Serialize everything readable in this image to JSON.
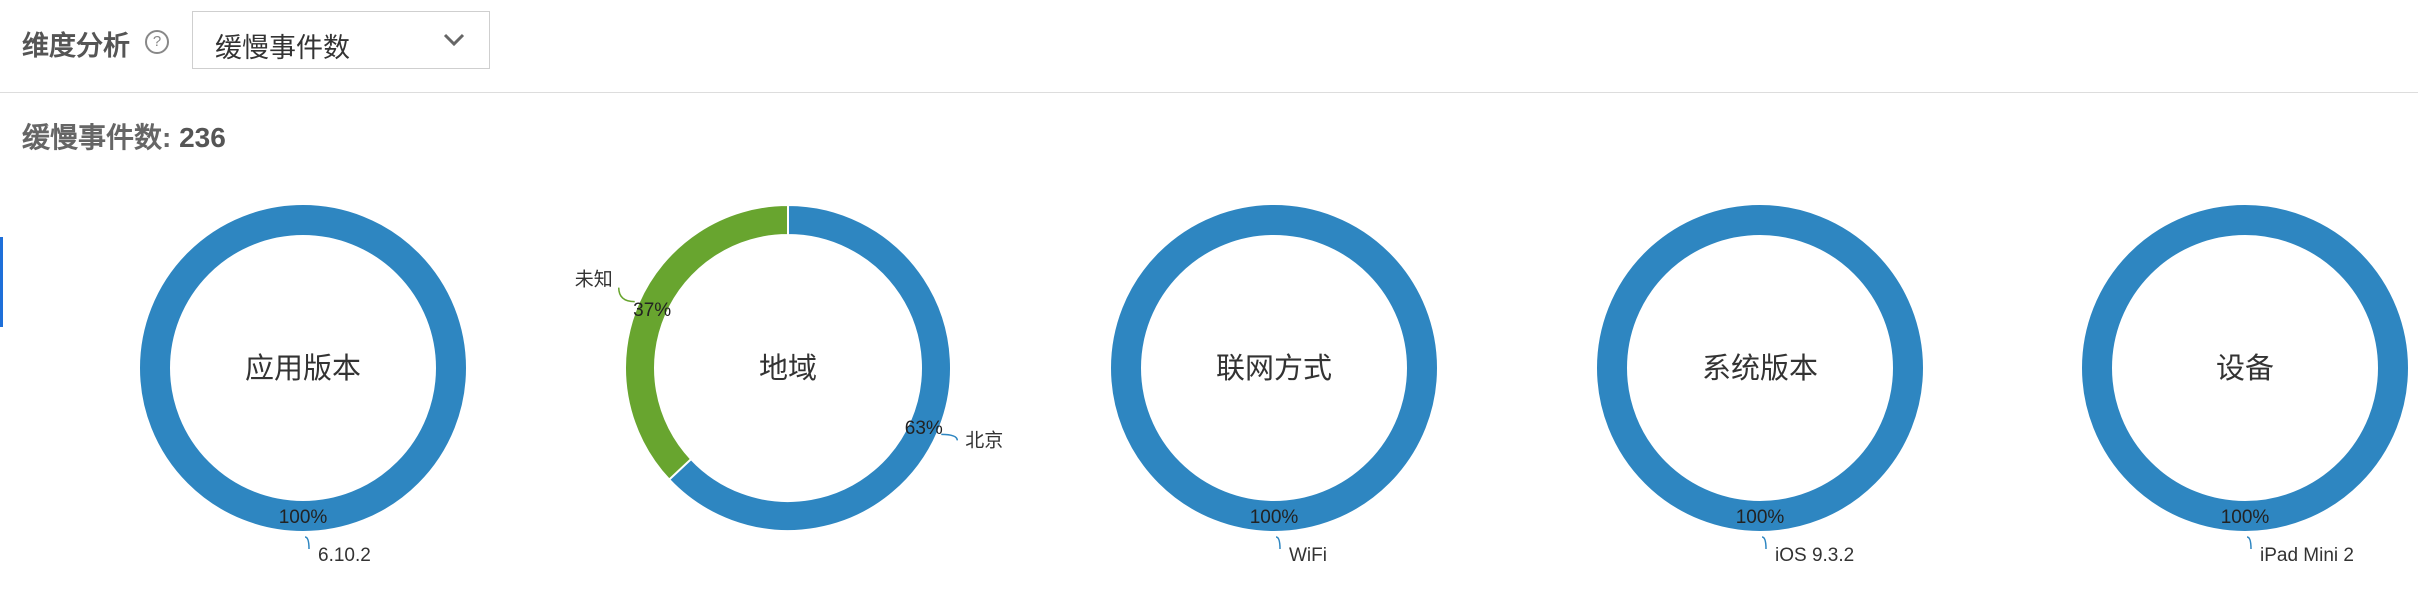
{
  "header": {
    "dimension_label": "维度分析",
    "help_icon": "?",
    "select_value": "缓慢事件数"
  },
  "summary": {
    "label": "缓慢事件数:",
    "value": "236"
  },
  "colors": {
    "blue": "#2e86c1",
    "green": "#68a52f"
  },
  "chart_data": [
    {
      "type": "pie",
      "style": "donut",
      "title": "应用版本",
      "slices": [
        {
          "label": "6.10.2",
          "value": 100,
          "display": "100%",
          "color": "#2e86c1"
        }
      ]
    },
    {
      "type": "pie",
      "style": "donut",
      "title": "地域",
      "slices": [
        {
          "label": "北京",
          "value": 63,
          "display": "63%",
          "color": "#2e86c1"
        },
        {
          "label": "未知",
          "value": 37,
          "display": "37%",
          "color": "#68a52f"
        }
      ]
    },
    {
      "type": "pie",
      "style": "donut",
      "title": "联网方式",
      "slices": [
        {
          "label": "WiFi",
          "value": 100,
          "display": "100%",
          "color": "#2e86c1"
        }
      ]
    },
    {
      "type": "pie",
      "style": "donut",
      "title": "系统版本",
      "slices": [
        {
          "label": "iOS 9.3.2",
          "value": 100,
          "display": "100%",
          "color": "#2e86c1"
        }
      ]
    },
    {
      "type": "pie",
      "style": "donut",
      "title": "设备",
      "slices": [
        {
          "label": "iPad Mini 2",
          "value": 100,
          "display": "100%",
          "color": "#2e86c1"
        }
      ]
    }
  ]
}
